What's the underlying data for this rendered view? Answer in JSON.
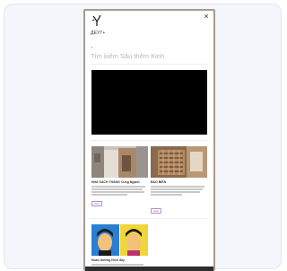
{
  "header": {
    "logo_text": "ДЕУГ+"
  },
  "nav": {
    "back_label": "◂"
  },
  "page": {
    "title": "Tìm kiếm Sâu thêm Kinh"
  },
  "tiles": [
    {
      "title": "NHÀ SÁCH THÁNG Cung Ngạnh",
      "more_label": "Xem"
    },
    {
      "title": "BÁO BIẾN",
      "more_label": "Xem"
    },
    {
      "title": "Huấn đường Hình đấy"
    }
  ],
  "colors": {
    "device_frame": "#a89c8c",
    "accent": "#8a5aa8",
    "video": "#000000"
  },
  "icons": [
    "close-icon",
    "logo-mark-icon"
  ]
}
